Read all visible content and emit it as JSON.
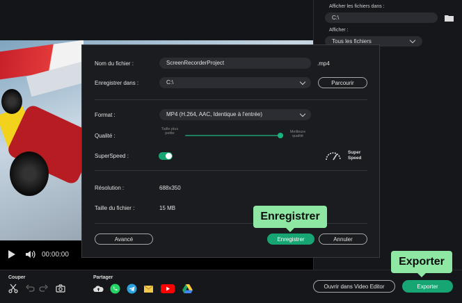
{
  "right_panel": {
    "show_files_in_label": "Afficher les fichiers dans :",
    "show_files_in_value": "C:\\",
    "show_label": "Afficher :",
    "show_value": "Tous les fichiers"
  },
  "player": {
    "time": "00:00:00"
  },
  "bottom_bar": {
    "cut_label": "Couper",
    "share_label": "Partager",
    "open_editor_label": "Ouvrir dans Video Editor",
    "export_label": "Exporter"
  },
  "dialog": {
    "filename_label": "Nom du fichier :",
    "filename_value": "ScreenRecorderProject",
    "extension": ".mp4",
    "save_in_label": "Enregistrer dans :",
    "save_in_value": "C:\\",
    "browse_label": "Parcourir",
    "format_label": "Format :",
    "format_value": "MP4 (H.264, AAC, Identique à l'entrée)",
    "quality_label": "Qualité :",
    "quality_min_label": "Taille plus petite",
    "quality_max_label": "Meilleure qualité",
    "quality_level": 0.98,
    "superspeed_label": "SuperSpeed :",
    "superspeed_on": true,
    "superspeed_badge": "Super Speed",
    "resolution_label": "Résolution :",
    "resolution_value": "688x350",
    "filesize_label": "Taille du fichier :",
    "filesize_value": "15 MB",
    "advanced_label": "Avancé",
    "save_label": "Enregistrer",
    "cancel_label": "Annuler"
  },
  "callouts": {
    "save": "Enregistrer",
    "export": "Exporter"
  },
  "colors": {
    "accent_green": "#17a673",
    "callout_green": "#8ee8a4"
  }
}
